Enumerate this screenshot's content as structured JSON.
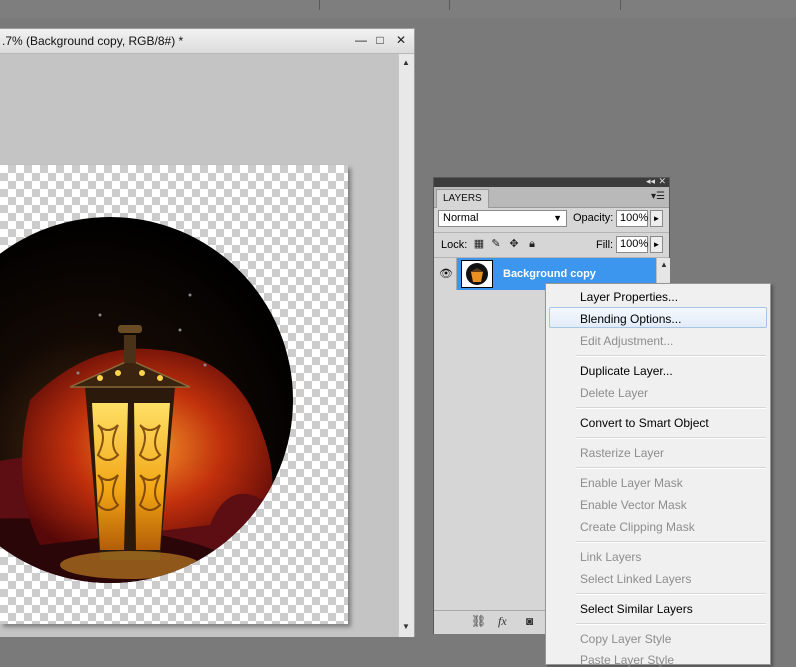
{
  "document": {
    "title": ".7% (Background copy, RGB/8#) *",
    "minimize_glyph": "—",
    "maximize_glyph": "□",
    "close_glyph": "✕"
  },
  "layers_panel": {
    "tab_label": "LAYERS",
    "blend_mode": "Normal",
    "opacity_label": "Opacity:",
    "opacity_value": "100%",
    "lock_label": "Lock:",
    "fill_label": "Fill:",
    "fill_value": "100%",
    "layer": {
      "name": "Background copy"
    }
  },
  "context_menu": {
    "items": [
      {
        "label": "Layer Properties...",
        "enabled": true
      },
      {
        "label": "Blending Options...",
        "enabled": true,
        "highlighted": true
      },
      {
        "label": "Edit Adjustment...",
        "enabled": false
      },
      {
        "label": "Duplicate Layer...",
        "enabled": true
      },
      {
        "label": "Delete Layer",
        "enabled": false
      },
      {
        "label": "Convert to Smart Object",
        "enabled": true
      },
      {
        "label": "Rasterize Layer",
        "enabled": false
      },
      {
        "label": "Enable Layer Mask",
        "enabled": false
      },
      {
        "label": "Enable Vector Mask",
        "enabled": false
      },
      {
        "label": "Create Clipping Mask",
        "enabled": false
      },
      {
        "label": "Link Layers",
        "enabled": false
      },
      {
        "label": "Select Linked Layers",
        "enabled": false
      },
      {
        "label": "Select Similar Layers",
        "enabled": true
      },
      {
        "label": "Copy Layer Style",
        "enabled": false
      },
      {
        "label": "Paste Layer Style",
        "enabled": false
      }
    ]
  },
  "colors": {
    "workspace": "#7a7a7a",
    "selection": "#3c96ee",
    "menu_bg": "#f0f0f0",
    "disabled_text": "#8d8d8d"
  }
}
